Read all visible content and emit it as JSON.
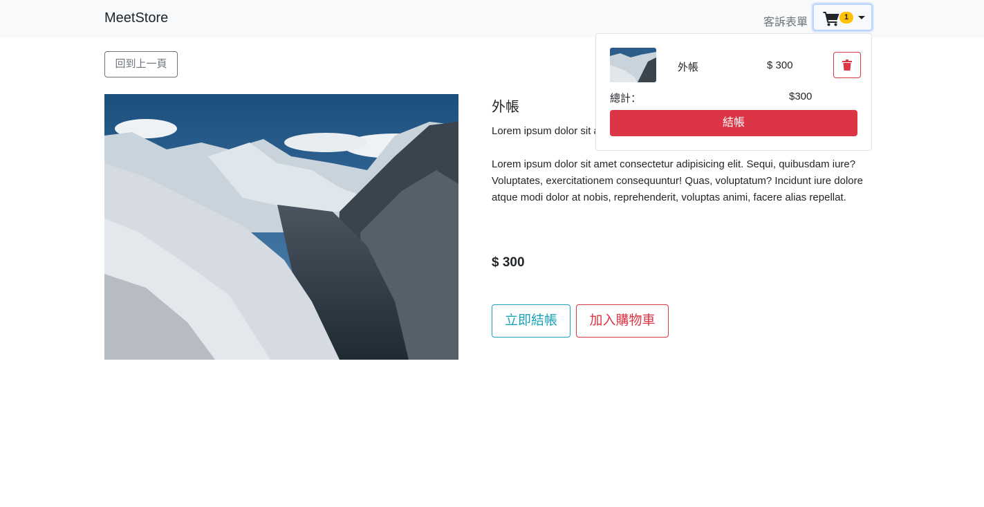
{
  "navbar": {
    "brand": "MeetStore",
    "link": "客訴表單",
    "cart_badge": "1",
    "cart_icon": "shopping-cart-icon"
  },
  "back_button": "回到上一頁",
  "product": {
    "image_icon": "mountain-photo",
    "title": "外帳",
    "short_desc": "Lorem ipsum dolor sit amet consectetur adipisicing elit.",
    "long_desc": "Lorem ipsum dolor sit amet consectetur adipisicing elit. Sequi, quibusdam iure? Voluptates, exercitationem consequuntur! Quas, voluptatum? Incidunt iure dolore atque modi dolor at nobis, reprehenderit, voluptas animi, facere alias repellat.",
    "price": "$ 300",
    "checkout_now": "立即結帳",
    "add_to_cart": "加入購物車"
  },
  "cart_dropdown": {
    "item": {
      "name": "外帳",
      "price": "$ 300",
      "delete_icon": "trash-icon"
    },
    "total_label": "總計：",
    "total_value": "$300",
    "checkout": "結帳"
  },
  "colors": {
    "info": "#17a2b8",
    "danger": "#dc3545",
    "warning": "#ffc107",
    "navbar_bg": "#f8f9fa"
  }
}
